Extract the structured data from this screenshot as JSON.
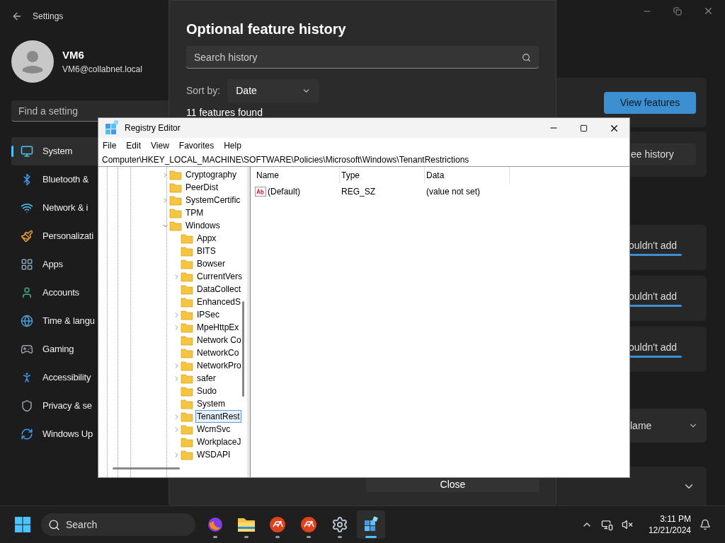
{
  "settings": {
    "title": "Settings",
    "user": {
      "name": "VM6",
      "email": "VM6@collabnet.local"
    },
    "search": {
      "placeholder": "Find a setting"
    },
    "nav": [
      {
        "label": "System",
        "selected": true
      },
      {
        "label": "Bluetooth &",
        "selected": false
      },
      {
        "label": "Network & i",
        "selected": false
      },
      {
        "label": "Personalizati",
        "selected": false
      },
      {
        "label": "Apps",
        "selected": false
      },
      {
        "label": "Accounts",
        "selected": false
      },
      {
        "label": "Time & langu",
        "selected": false
      },
      {
        "label": "Gaming",
        "selected": false
      },
      {
        "label": "Accessibility",
        "selected": false
      },
      {
        "label": "Privacy & se",
        "selected": false
      },
      {
        "label": "Windows Up",
        "selected": false
      }
    ],
    "panel": {
      "view_button": "View features",
      "history_button": "ee history",
      "failed_items": [
        {
          "status": "ouldn't add"
        },
        {
          "status": "ouldn't add"
        },
        {
          "status": "ouldn't add"
        }
      ],
      "sort_value": "lame"
    }
  },
  "dialog": {
    "title": "Optional feature history",
    "search": {
      "placeholder": "Search history"
    },
    "sort_label": "Sort by:",
    "sort_value": "Date",
    "result_count": "11 features found",
    "close_button": "Close"
  },
  "registry": {
    "title": "Registry Editor",
    "menu": [
      "File",
      "Edit",
      "View",
      "Favorites",
      "Help"
    ],
    "address": "Computer\\HKEY_LOCAL_MACHINE\\SOFTWARE\\Policies\\Microsoft\\Windows\\TenantRestrictions",
    "tree": [
      {
        "label": "Cryptography",
        "expandable": true,
        "selected": false
      },
      {
        "label": "PeerDist",
        "expandable": false,
        "selected": false
      },
      {
        "label": "SystemCertific",
        "expandable": true,
        "selected": false
      },
      {
        "label": "TPM",
        "expandable": false,
        "selected": false
      },
      {
        "label": "Windows",
        "expandable": true,
        "expanded": true,
        "selected": false,
        "children": [
          {
            "label": "Appx",
            "expandable": false,
            "selected": false
          },
          {
            "label": "BITS",
            "expandable": false,
            "selected": false
          },
          {
            "label": "Bowser",
            "expandable": false,
            "selected": false
          },
          {
            "label": "CurrentVers",
            "expandable": true,
            "selected": false
          },
          {
            "label": "DataCollect",
            "expandable": false,
            "selected": false
          },
          {
            "label": "EnhancedS",
            "expandable": false,
            "selected": false
          },
          {
            "label": "IPSec",
            "expandable": true,
            "selected": false
          },
          {
            "label": "MpeHttpEx",
            "expandable": true,
            "selected": false
          },
          {
            "label": "Network Co",
            "expandable": false,
            "selected": false
          },
          {
            "label": "NetworkCo",
            "expandable": false,
            "selected": false
          },
          {
            "label": "NetworkPro",
            "expandable": true,
            "selected": false
          },
          {
            "label": "safer",
            "expandable": true,
            "selected": false
          },
          {
            "label": "Sudo",
            "expandable": false,
            "selected": false
          },
          {
            "label": "System",
            "expandable": false,
            "selected": false
          },
          {
            "label": "TenantRest",
            "expandable": true,
            "selected": true
          },
          {
            "label": "WcmSvc",
            "expandable": true,
            "selected": false
          },
          {
            "label": "WorkplaceJ",
            "expandable": false,
            "selected": false
          },
          {
            "label": "WSDAPI",
            "expandable": true,
            "selected": false
          }
        ]
      }
    ],
    "columns": [
      "Name",
      "Type",
      "Data"
    ],
    "values": [
      {
        "name": "(Default)",
        "type": "REG_SZ",
        "data": "(value not set)"
      }
    ]
  },
  "taskbar": {
    "search": {
      "placeholder": "Search"
    },
    "apps": [
      {
        "kind": "firefox",
        "active": false
      },
      {
        "kind": "explorer",
        "active": false
      },
      {
        "kind": "ea",
        "active": false
      },
      {
        "kind": "ea",
        "active": false
      },
      {
        "kind": "settings",
        "active": false
      },
      {
        "kind": "registry",
        "active": true
      }
    ],
    "time": "3:11 PM",
    "date": "12/21/2024"
  }
}
